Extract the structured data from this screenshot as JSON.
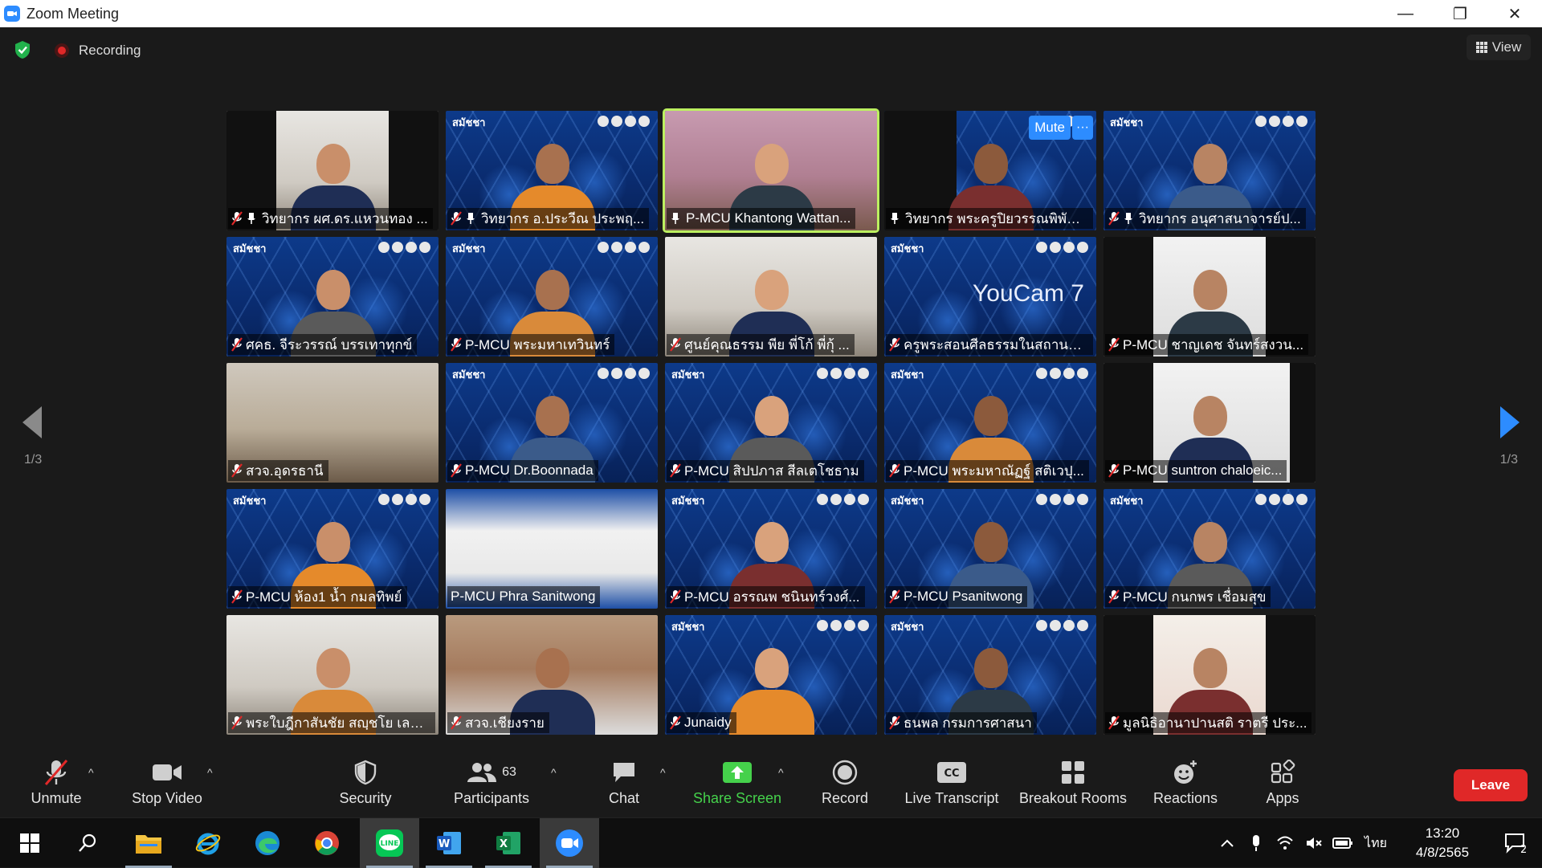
{
  "window": {
    "title": "Zoom Meeting",
    "minimize": "—",
    "maximize": "❐",
    "close": "✕"
  },
  "meeting": {
    "recording_label": "Recording",
    "view_label": "View",
    "page_left": "1/3",
    "page_right": "1/3",
    "tile_mute_label": "Mute",
    "tile_more_label": "···"
  },
  "participants": [
    {
      "name": "วิทยากร ผศ.ดร.แหวนทอง ...",
      "bg": "office",
      "muted": true,
      "pinned": true,
      "active": false
    },
    {
      "name": "วิทยากร อ.ประวีณ ประพฤ...",
      "bg": "blue",
      "muted": true,
      "pinned": true,
      "active": false
    },
    {
      "name": "P-MCU Khantong Wattan...",
      "bg": "pink",
      "muted": false,
      "pinned": true,
      "active": true
    },
    {
      "name": "วิทยากร พระครูปิยวรรณพิพัฒ...",
      "bg": "blue",
      "muted": false,
      "pinned": true,
      "active": false
    },
    {
      "name": "วิทยากร อนุศาสนาจารย์ป...",
      "bg": "blue",
      "muted": true,
      "pinned": true,
      "active": false
    },
    {
      "name": "ศคธ. จีระวรรณ์ บรรเทาทุกข์",
      "bg": "blue",
      "muted": true,
      "pinned": false,
      "active": false
    },
    {
      "name": "P-MCU พระมหาเทวินทร์",
      "bg": "blue",
      "muted": true,
      "pinned": false,
      "active": false
    },
    {
      "name": "ศูนย์คุณธรรม พีย พี่โก้ พี่กุ้ ...",
      "bg": "office",
      "muted": true,
      "pinned": false,
      "active": false
    },
    {
      "name": "ครูพระสอนศีลธรรมในสถานศึก...",
      "bg": "blue",
      "muted": true,
      "pinned": false,
      "active": false
    },
    {
      "name": "P-MCU ชาญเดช จันทร์สงวน...",
      "bg": "light",
      "muted": true,
      "pinned": false,
      "active": false
    },
    {
      "name": "สวจ.อุดรธานี",
      "bg": "room",
      "muted": true,
      "pinned": false,
      "active": false
    },
    {
      "name": "P-MCU Dr.Boonnada",
      "bg": "blue",
      "muted": true,
      "pinned": false,
      "active": false
    },
    {
      "name": "P-MCU สิปปภาส สีลเตโชธาม",
      "bg": "blue",
      "muted": true,
      "pinned": false,
      "active": false
    },
    {
      "name": "P-MCU พระมหาณัฏฐ์ สติเวปุ...",
      "bg": "blue",
      "muted": true,
      "pinned": false,
      "active": false
    },
    {
      "name": "P-MCU suntron chaloeic...",
      "bg": "light",
      "muted": true,
      "pinned": false,
      "active": false
    },
    {
      "name": "P-MCU ห้อง1 น้ำ กมลทิพย์",
      "bg": "blue",
      "muted": true,
      "pinned": false,
      "active": false
    },
    {
      "name": "P-MCU Phra Sanitwong",
      "bg": "poster",
      "muted": false,
      "pinned": false,
      "active": false
    },
    {
      "name": "P-MCU อรรณพ ชนินทร์วงศ์...",
      "bg": "blue",
      "muted": true,
      "pinned": false,
      "active": false
    },
    {
      "name": "P-MCU Psanitwong",
      "bg": "blue",
      "muted": true,
      "pinned": false,
      "active": false
    },
    {
      "name": "P-MCU กนกพร เชื่อมสุข",
      "bg": "blue",
      "muted": true,
      "pinned": false,
      "active": false
    },
    {
      "name": "พระใบฎีกาสันชัย สญฺชโย เลข...",
      "bg": "office",
      "muted": true,
      "pinned": false,
      "active": false
    },
    {
      "name": "สวจ.เชียงราย",
      "bg": "brick",
      "muted": true,
      "pinned": false,
      "active": false
    },
    {
      "name": "Junaidy",
      "bg": "blue",
      "muted": true,
      "pinned": false,
      "active": false
    },
    {
      "name": "ธนพล กรมการศาสนา",
      "bg": "blue",
      "muted": true,
      "pinned": false,
      "active": false
    },
    {
      "name": "มูลนิธิอานาปานสติ ราตรี ประ...",
      "bg": "white",
      "muted": true,
      "pinned": false,
      "active": false
    }
  ],
  "tile_extras": {
    "brand_text": "สมัชชา",
    "youcam_text": "YouCam 7"
  },
  "toolbar": {
    "unmute": "Unmute",
    "stop_video": "Stop Video",
    "security": "Security",
    "participants": "Participants",
    "participants_count": "63",
    "chat": "Chat",
    "share_screen": "Share Screen",
    "record": "Record",
    "live_transcript": "Live Transcript",
    "live_transcript_icon_text": "CC",
    "breakout_rooms": "Breakout Rooms",
    "reactions": "Reactions",
    "apps": "Apps",
    "leave": "Leave",
    "colors": {
      "share_green": "#45d14b",
      "leave_red": "#e02828",
      "zoom_blue": "#2d8cff",
      "active_speaker": "#bcf060"
    }
  },
  "taskbar": {
    "apps": [
      "windows-start",
      "search",
      "file-explorer",
      "internet-explorer",
      "edge",
      "chrome",
      "line",
      "word",
      "excel",
      "zoom"
    ],
    "line_text": "LINE",
    "word_text": "W",
    "excel_text": "X",
    "language": "ไทย",
    "time": "13:20",
    "date": "4/8/2565",
    "notification_count": "2"
  }
}
